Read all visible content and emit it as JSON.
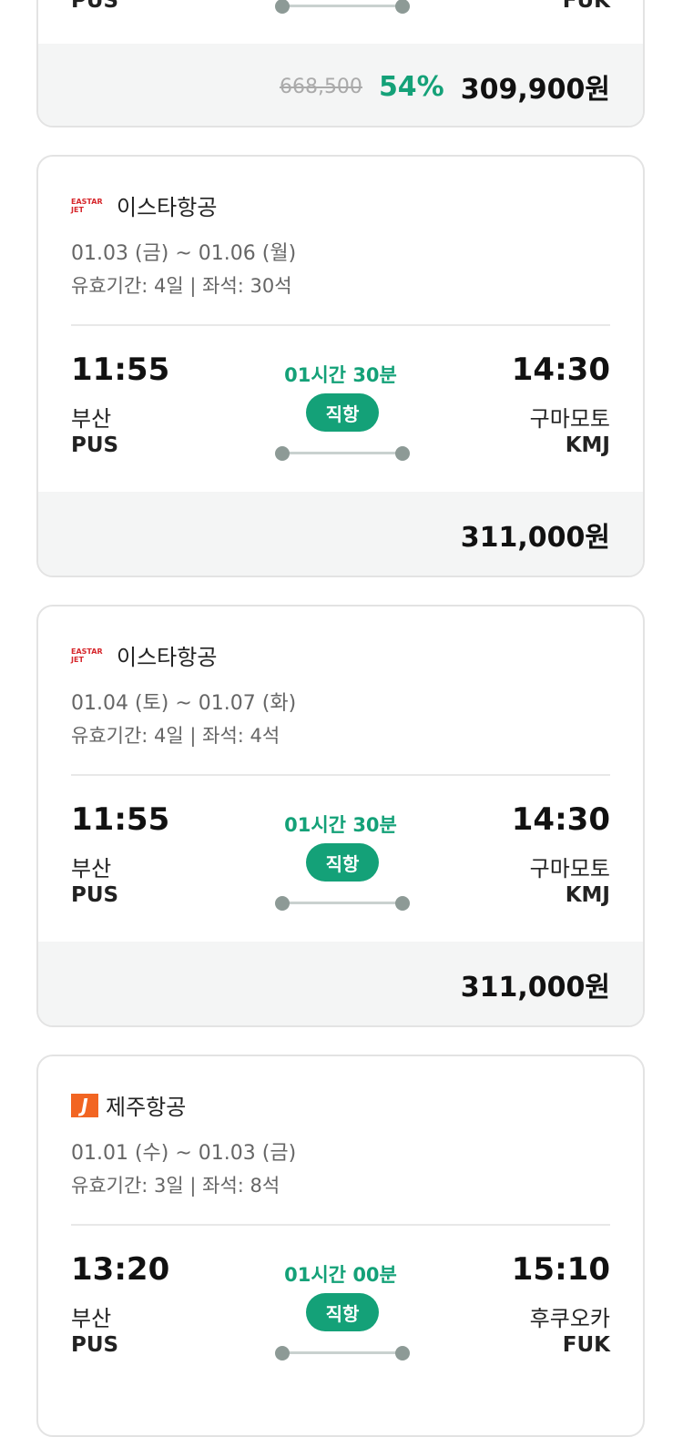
{
  "top_card": {
    "dep_code": "PUS",
    "arr_code": "FUK",
    "original_price": "668,500",
    "discount": "54%",
    "price": "309,900원"
  },
  "cards": [
    {
      "airline_logo": "EASTAR JET",
      "airline": "이스타항공",
      "dates": "01.03 (금) ~ 01.06 (월)",
      "meta": "유효기간: 4일 | 좌석: 30석",
      "dep_time": "11:55",
      "arr_time": "14:30",
      "duration": "01시간 30분",
      "direct": "직항",
      "dep_city": "부산",
      "arr_city": "구마모토",
      "dep_code": "PUS",
      "arr_code": "KMJ",
      "price": "311,000원"
    },
    {
      "airline_logo": "EASTAR JET",
      "airline": "이스타항공",
      "dates": "01.04 (토) ~ 01.07 (화)",
      "meta": "유효기간: 4일 | 좌석: 4석",
      "dep_time": "11:55",
      "arr_time": "14:30",
      "duration": "01시간 30분",
      "direct": "직항",
      "dep_city": "부산",
      "arr_city": "구마모토",
      "dep_code": "PUS",
      "arr_code": "KMJ",
      "price": "311,000원"
    },
    {
      "airline_logo": "J",
      "airline": "제주항공",
      "dates": "01.01 (수) ~ 01.03 (금)",
      "meta": "유효기간: 3일 | 좌석: 8석",
      "dep_time": "13:20",
      "arr_time": "15:10",
      "duration": "01시간 00분",
      "direct": "직항",
      "dep_city": "부산",
      "arr_city": "후쿠오카",
      "dep_code": "PUS",
      "arr_code": "FUK"
    }
  ],
  "colors": {
    "accent": "#14a178",
    "eastar": "#d6262b",
    "jeju": "#f26522"
  }
}
